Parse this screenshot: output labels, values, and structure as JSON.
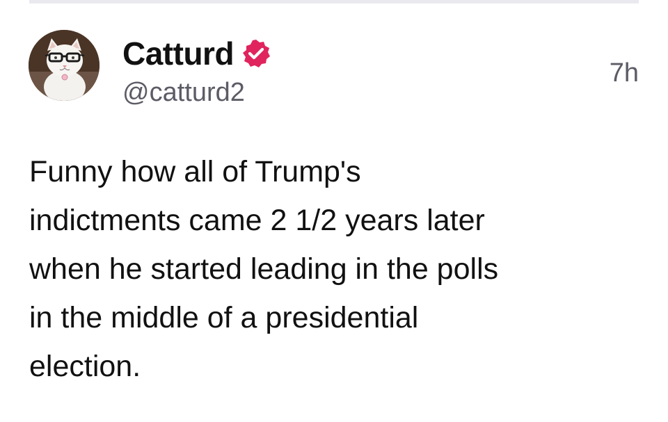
{
  "post": {
    "author": {
      "display_name": "Catturd",
      "handle": "@catturd2",
      "verified": true,
      "verified_badge_icon": "verified-badge-icon",
      "verified_badge_color": "#e0245e",
      "avatar_icon": "cat-with-glasses-avatar"
    },
    "timestamp": "7h",
    "text_lines": [
      "Funny how all of Trump's",
      "indictments came 2 1/2 years later",
      "when he started leading in the polls",
      "in the middle of a presidential",
      "election."
    ]
  },
  "colors": {
    "background": "#ffffff",
    "text_primary": "#111111",
    "text_secondary": "#5c5c66",
    "divider": "#e9e9ef"
  }
}
